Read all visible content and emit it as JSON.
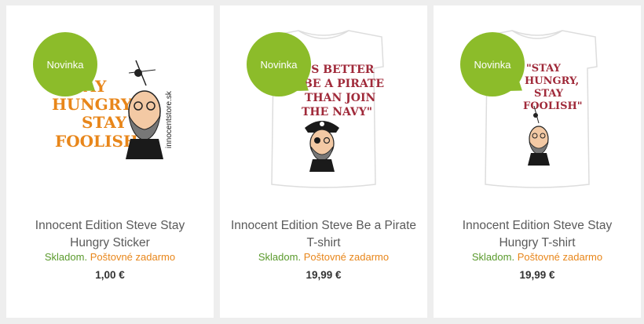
{
  "products": [
    {
      "badge": "Novinka",
      "title": "Innocent Edition Steve Stay Hungry Sticker",
      "stock": "Skladom.",
      "shipping": "Poštovné zadarmo",
      "price": "1,00 €",
      "image": {
        "lines": [
          "\"STAY",
          "HUNGRY,",
          "STAY",
          "FOOLISH\""
        ],
        "side_text": "innocentstore.sk",
        "color": "#e8861a"
      }
    },
    {
      "badge": "Novinka",
      "title": "Innocent Edition Steve Be a Pirate T-shirt",
      "stock": "Skladom.",
      "shipping": "Poštovné zadarmo",
      "price": "19,99 €",
      "image": {
        "lines": [
          "'S BETTER",
          "BE A PIRATE",
          "THAN JOIN",
          "THE NAVY\""
        ],
        "color": "#a02a3a"
      }
    },
    {
      "badge": "Novinka",
      "title": "Innocent Edition Steve Stay Hungry T-shirt",
      "stock": "Skladom.",
      "shipping": "Poštovné zadarmo",
      "price": "19,99 €",
      "image": {
        "lines": [
          "\"STAY",
          "HUNGRY,",
          "STAY",
          "FOOLISH\""
        ],
        "color": "#a02a3a"
      }
    }
  ],
  "colors": {
    "badge": "#8cbc2a",
    "in_stock": "#5a9a2c",
    "shipping": "#e8861a"
  }
}
